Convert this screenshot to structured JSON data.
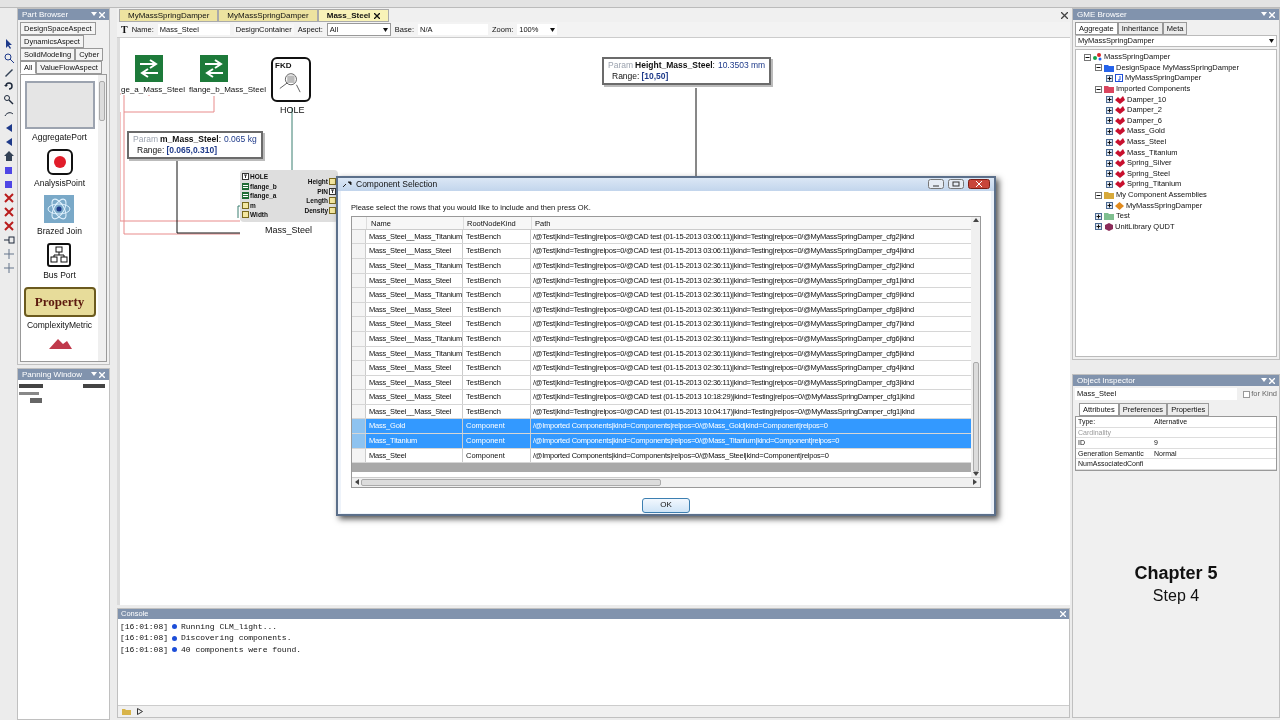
{
  "part_browser": {
    "title": "Part Browser",
    "tab_rows": [
      [
        {
          "label": "DesignSpaceAspect",
          "selected": false
        }
      ],
      [
        {
          "label": "DynamicsAspect",
          "selected": false
        }
      ],
      [
        {
          "label": "SolidModeling",
          "selected": false
        },
        {
          "label": "Cyber",
          "selected": false
        }
      ],
      [
        {
          "label": "All",
          "selected": true
        },
        {
          "label": "ValueFlowAspect",
          "selected": false
        }
      ]
    ],
    "parts": [
      {
        "kind": "blank",
        "label": "AggregatePort"
      },
      {
        "kind": "dot",
        "label": "AnalysisPoint"
      },
      {
        "kind": "atom",
        "label": "Brazed Join"
      },
      {
        "kind": "network",
        "label": "Bus Port"
      },
      {
        "kind": "property",
        "tile_text": "Property",
        "label": "ComplexityMetric"
      },
      {
        "kind": "shape"
      }
    ]
  },
  "panning_window": {
    "title": "Panning Window"
  },
  "editor_tabs": [
    {
      "label": "MyMassSpringDamper",
      "selected": false
    },
    {
      "label": "MyMassSpringDamper",
      "selected": false
    },
    {
      "label": "Mass_Steel",
      "selected": true
    }
  ],
  "name_bar": {
    "text_tool": "T",
    "name_label": "Name:",
    "name": "Mass_Steel",
    "kind": "DesignContainer",
    "aspect_label": "Aspect:",
    "aspect": "All",
    "base_label": "Base:",
    "base": "N/A",
    "zoom_label": "Zoom:",
    "zoom": "100%"
  },
  "canvas": {
    "flanges": [
      {
        "label": "ge_a_Mass_Steel"
      },
      {
        "label": "flange_b_Mass_Steel"
      }
    ],
    "hole": {
      "tag": "FKD",
      "label": "HOLE"
    },
    "params": [
      {
        "prefix": "Param",
        "name": "m_Mass_Steel",
        "separator": ":",
        "value": "0.065 kg",
        "range_label": "Range:",
        "range": "[0.065,0.310]"
      },
      {
        "prefix": "Param",
        "name": "Height_Mass_Steel",
        "separator": ":",
        "value": "10.3503 mm",
        "range_label": "Range:",
        "range": "[10,50]"
      }
    ],
    "component": {
      "label": "Mass_Steel",
      "left_ports": [
        {
          "kind": "hole",
          "label": "HOLE"
        },
        {
          "kind": "flange",
          "label": "flange_b"
        },
        {
          "kind": "flange",
          "label": "flange_a"
        },
        {
          "kind": "param",
          "label": "m"
        },
        {
          "kind": "param",
          "label": "Width"
        }
      ],
      "right_ports": [
        {
          "kind": "param",
          "label": "Height"
        },
        {
          "kind": "hole",
          "label": "PIN"
        },
        {
          "kind": "param",
          "label": "Length"
        },
        {
          "kind": "param",
          "label": "Density"
        }
      ]
    }
  },
  "dialog": {
    "title": "Component Selection",
    "instruction": "Please select the rows that you would like to include and then press OK.",
    "columns": [
      "Name",
      "RootNodeKind",
      "Path"
    ],
    "rows": [
      {
        "name": "Mass_Steel__Mass_Titanium",
        "kind": "TestBench",
        "path": "/@Test|kind=Testing|relpos=0/@CAD test (01-15-2013 03:06:11)|kind=Testing|relpos=0/@MyMassSpringDamper_cfg2|kind",
        "selected": false
      },
      {
        "name": "Mass_Steel__Mass_Steel",
        "kind": "TestBench",
        "path": "/@Test|kind=Testing|relpos=0/@CAD test (01-15-2013 03:06:11)|kind=Testing|relpos=0/@MyMassSpringDamper_cfg4|kind",
        "selected": false
      },
      {
        "name": "Mass_Steel__Mass_Titanium",
        "kind": "TestBench",
        "path": "/@Test|kind=Testing|relpos=0/@CAD test (01-15-2013 02:36:11)|kind=Testing|relpos=0/@MyMassSpringDamper_cfg2|kind",
        "selected": false
      },
      {
        "name": "Mass_Steel__Mass_Steel",
        "kind": "TestBench",
        "path": "/@Test|kind=Testing|relpos=0/@CAD test (01-15-2013 02:36:11)|kind=Testing|relpos=0/@MyMassSpringDamper_cfg1|kind",
        "selected": false
      },
      {
        "name": "Mass_Steel__Mass_Titanium",
        "kind": "TestBench",
        "path": "/@Test|kind=Testing|relpos=0/@CAD test (01-15-2013 02:36:11)|kind=Testing|relpos=0/@MyMassSpringDamper_cfg9|kind",
        "selected": false
      },
      {
        "name": "Mass_Steel__Mass_Steel",
        "kind": "TestBench",
        "path": "/@Test|kind=Testing|relpos=0/@CAD test (01-15-2013 02:36:11)|kind=Testing|relpos=0/@MyMassSpringDamper_cfg8|kind",
        "selected": false
      },
      {
        "name": "Mass_Steel__Mass_Steel",
        "kind": "TestBench",
        "path": "/@Test|kind=Testing|relpos=0/@CAD test (01-15-2013 02:36:11)|kind=Testing|relpos=0/@MyMassSpringDamper_cfg7|kind",
        "selected": false
      },
      {
        "name": "Mass_Steel__Mass_Titanium",
        "kind": "TestBench",
        "path": "/@Test|kind=Testing|relpos=0/@CAD test (01-15-2013 02:36:11)|kind=Testing|relpos=0/@MyMassSpringDamper_cfg6|kind",
        "selected": false
      },
      {
        "name": "Mass_Steel__Mass_Titanium",
        "kind": "TestBench",
        "path": "/@Test|kind=Testing|relpos=0/@CAD test (01-15-2013 02:36:11)|kind=Testing|relpos=0/@MyMassSpringDamper_cfg5|kind",
        "selected": false
      },
      {
        "name": "Mass_Steel__Mass_Steel",
        "kind": "TestBench",
        "path": "/@Test|kind=Testing|relpos=0/@CAD test (01-15-2013 02:36:11)|kind=Testing|relpos=0/@MyMassSpringDamper_cfg4|kind",
        "selected": false
      },
      {
        "name": "Mass_Steel__Mass_Steel",
        "kind": "TestBench",
        "path": "/@Test|kind=Testing|relpos=0/@CAD test (01-15-2013 02:36:11)|kind=Testing|relpos=0/@MyMassSpringDamper_cfg3|kind",
        "selected": false
      },
      {
        "name": "Mass_Steel__Mass_Steel",
        "kind": "TestBench",
        "path": "/@Test|kind=Testing|relpos=0/@CAD test (01-15-2013 10:18:29)|kind=Testing|relpos=0/@MyMassSpringDamper_cfg1|kind",
        "selected": false
      },
      {
        "name": "Mass_Steel__Mass_Steel",
        "kind": "TestBench",
        "path": "/@Test|kind=Testing|relpos=0/@CAD test (01-15-2013 10:04:17)|kind=Testing|relpos=0/@MyMassSpringDamper_cfg1|kind",
        "selected": false
      },
      {
        "name": "Mass_Gold",
        "kind": "Component",
        "path": "/@Imported Components|kind=Components|relpos=0/@Mass_Gold|kind=Component|relpos=0",
        "selected": true
      },
      {
        "name": "Mass_Titanium",
        "kind": "Component",
        "path": "/@Imported Components|kind=Components|relpos=0/@Mass_Titanium|kind=Component|relpos=0",
        "selected": true
      },
      {
        "name": "Mass_Steel",
        "kind": "Component",
        "path": "/@Imported Components|kind=Components|relpos=0/@Mass_Steel|kind=Component|relpos=0",
        "selected": false
      }
    ],
    "ok": "OK"
  },
  "console": {
    "title": "Console",
    "lines": [
      {
        "time": "[16:01:08]",
        "text": "Running CLM_light..."
      },
      {
        "time": "[16:01:08]",
        "text": "Discovering components."
      },
      {
        "time": "[16:01:08]",
        "text": "40 components were found."
      }
    ]
  },
  "browser": {
    "title": "GME Browser",
    "tabs": [
      {
        "label": "Aggregate",
        "selected": true
      },
      {
        "label": "Inheritance",
        "selected": false
      },
      {
        "label": "Meta",
        "selected": false
      }
    ],
    "project": "MyMassSpringDamper",
    "tree": [
      {
        "kind": "root",
        "label": "MassSpringDamper",
        "expanded": true,
        "children": [
          {
            "kind": "design_space",
            "label": "DesignSpace MyMassSpringDamper",
            "expanded": true,
            "children": [
              {
                "kind": "design",
                "label": "MyMassSpringDamper",
                "expanded": false
              }
            ]
          },
          {
            "kind": "folder_red",
            "label": "Imported Components",
            "expanded": true,
            "children": [
              {
                "kind": "component",
                "label": "Damper_10",
                "expanded": false
              },
              {
                "kind": "component",
                "label": "Damper_2",
                "expanded": false
              },
              {
                "kind": "component",
                "label": "Damper_6",
                "expanded": false
              },
              {
                "kind": "component",
                "label": "Mass_Gold",
                "expanded": false
              },
              {
                "kind": "component",
                "label": "Mass_Steel",
                "expanded": false
              },
              {
                "kind": "component",
                "label": "Mass_Titanium",
                "expanded": false
              },
              {
                "kind": "component",
                "label": "Spring_Silver",
                "expanded": false
              },
              {
                "kind": "component",
                "label": "Spring_Steel",
                "expanded": false
              },
              {
                "kind": "component",
                "label": "Spring_Titanium",
                "expanded": false
              }
            ]
          },
          {
            "kind": "folder_yellow",
            "label": "My Component Assemblies",
            "expanded": true,
            "children": [
              {
                "kind": "assembly",
                "label": "MyMassSpringDamper",
                "expanded": false
              }
            ]
          },
          {
            "kind": "folder_green",
            "label": "Test",
            "expanded": false
          },
          {
            "kind": "library",
            "label": "UnitLibrary QUDT",
            "expanded": false
          }
        ]
      }
    ]
  },
  "inspector": {
    "title": "Object Inspector",
    "name": "Mass_Steel",
    "for_kind": {
      "label": "for Kind",
      "checked": false
    },
    "tabs": [
      {
        "label": "Attributes",
        "selected": true
      },
      {
        "label": "Preferences",
        "selected": false
      },
      {
        "label": "Properties",
        "selected": false
      }
    ],
    "rows": [
      {
        "label": "Type:",
        "value": "Alternative",
        "disabled": false
      },
      {
        "label": "Cardinality",
        "disabled": true
      },
      {
        "label": "ID",
        "value": "9",
        "disabled": false
      },
      {
        "label": "Generation Semantic",
        "value": "Normal",
        "disabled": false
      },
      {
        "label": "NumAssociatedConfi",
        "disabled": false
      }
    ]
  },
  "caption": {
    "title": "Chapter 5",
    "subtitle": "Step 4"
  }
}
